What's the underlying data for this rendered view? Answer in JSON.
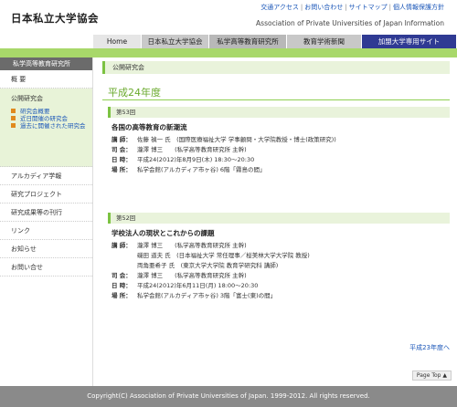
{
  "header": {
    "logo": "日本私立大学協会",
    "util_links": [
      "交通アクセス",
      "お問い合わせ",
      "サイトマップ",
      "個人情報保護方針"
    ],
    "english_name": "Association of Private Universities of Japan Information"
  },
  "nav": [
    "Home",
    "日本私立大学協会",
    "私学高等教育研究所",
    "教育学術新聞",
    "加盟大学専用サイト"
  ],
  "sidebar": {
    "head": "私学高等教育研究所",
    "items": [
      "概 要",
      "公開研究会",
      "アルカディア学報",
      "研究プロジェクト",
      "研究成果等の刊行",
      "リンク",
      "お知らせ",
      "お問い合せ"
    ],
    "subitems": [
      "研究会概要",
      "近日開催の研究会",
      "過去に開催された研究会"
    ]
  },
  "main": {
    "section": "公開研究会",
    "year": "平成24年度",
    "events": [
      {
        "no": "第53回",
        "title": "各国の高等教育の新潮流",
        "lecturer": "佐藤 禎一 氏　(国際医療福祉大学 学事顧問・大学院教授・博士(政策研究))",
        "chair": "瀧澤 博三　　(私学高等教育研究所 主幹)",
        "date": "平成24(2012)年8月9日(木) 18:30〜20:30",
        "place": "私学会館(アルカディア市ヶ谷) 6階「霧島の間」"
      },
      {
        "no": "第52回",
        "title": "学校法人の現状とこれからの課題",
        "lecturers": [
          "瀧澤 博三　　(私学高等教育研究所 主幹)",
          "磯田 道夫 氏　(日本福祉大学 常任理事／桜美林大学大学院 教授)",
          "両角亜希子 氏　(東京大学大学院 教育学研究科 講師)"
        ],
        "chair": "瀧澤 博三　　(私学高等教育研究所 主幹)",
        "date": "平成24(2012)年6月11日(月) 18:00〜20:30",
        "place": "私学会館(アルカディア市ヶ谷) 3階「富士(東)の間」"
      }
    ],
    "labels": {
      "lecturer": "講 師：",
      "chair": "司 会：",
      "date": "日 時：",
      "place": "場 所："
    },
    "prev_link": "平成23年度へ",
    "page_top": "Page Top ▲"
  },
  "footer": "Copyright(C) Association of Private Universities of Japan. 1999-2012. All rights reserved."
}
